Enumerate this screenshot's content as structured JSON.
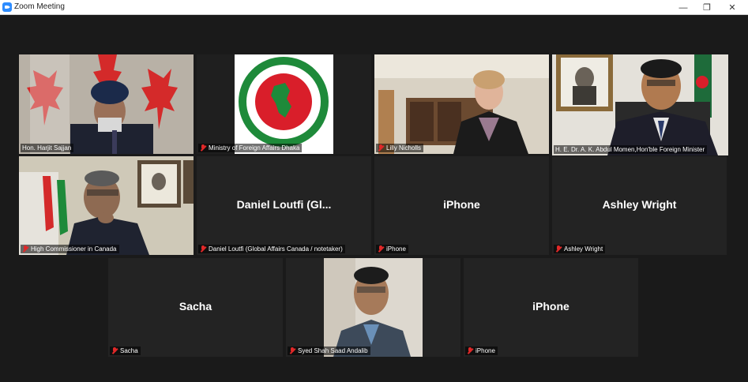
{
  "window": {
    "title": "Zoom Meeting",
    "minimize": "—",
    "restore": "❐",
    "close": "✕"
  },
  "participants": [
    {
      "name": "Hon. Harjit Sajjan",
      "muted": false,
      "video": true
    },
    {
      "name": "Ministry of Foreign Affairs Dhaka",
      "muted": true,
      "video": true
    },
    {
      "name": "Lilly Nicholls",
      "muted": true,
      "video": true
    },
    {
      "name": "H. E. Dr. A. K. Abdul Momen,Hon'ble Foreign Minister",
      "muted": false,
      "video": true,
      "active_speaker": true
    },
    {
      "name": "High Commissioner in Canada",
      "muted": true,
      "video": true
    },
    {
      "name": "Daniel Loutfi (Global Affairs Canada / notetaker)",
      "display": "Daniel  Loutfi  (Gl...",
      "muted": true,
      "video": false
    },
    {
      "name": "iPhone",
      "display": "iPhone",
      "muted": true,
      "video": false
    },
    {
      "name": "Ashley Wright",
      "display": "Ashley Wright",
      "muted": true,
      "video": false
    },
    {
      "name": "Sacha",
      "display": "Sacha",
      "muted": true,
      "video": false
    },
    {
      "name": "Syed Shah Saad Andalib",
      "muted": true,
      "video": true
    },
    {
      "name": "iPhone",
      "display": "iPhone",
      "muted": true,
      "video": false
    }
  ],
  "colors": {
    "active_speaker_border": "#a8e05f",
    "muted_icon": "#e02828",
    "tile_bg": "#232323",
    "stage_bg": "#1a1a1a"
  }
}
